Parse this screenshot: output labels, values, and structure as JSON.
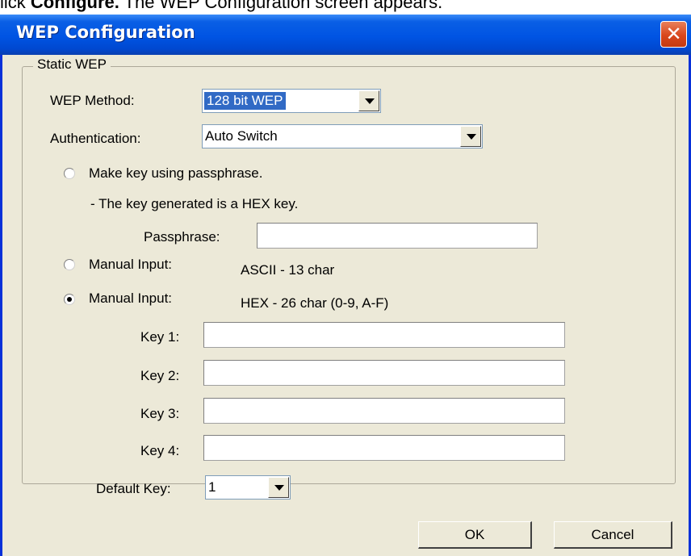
{
  "doc": {
    "prefix": "lick ",
    "bold": "Configure.",
    "suffix": " The WEP Configuration screen appears."
  },
  "window": {
    "title": "WEP Configuration",
    "close_glyph": "✕"
  },
  "group": {
    "legend": "Static WEP"
  },
  "wep_method": {
    "label": "WEP Method:",
    "value": "128 bit WEP"
  },
  "authentication": {
    "label": "Authentication:",
    "value": "Auto Switch"
  },
  "passphrase_option": {
    "label": "Make key using passphrase.",
    "note": "- The key generated is a HEX key.",
    "field_label": "Passphrase:",
    "field_value": ""
  },
  "manual_ascii": {
    "label": "Manual Input:",
    "desc": "ASCII - 13 char",
    "checked": false
  },
  "manual_hex": {
    "label": "Manual Input:",
    "desc": "HEX - 26 char (0-9, A-F)",
    "checked": true
  },
  "keys": [
    {
      "label": "Key 1:",
      "value": ""
    },
    {
      "label": "Key 2:",
      "value": ""
    },
    {
      "label": "Key 3:",
      "value": ""
    },
    {
      "label": "Key 4:",
      "value": ""
    }
  ],
  "default_key": {
    "label": "Default Key:",
    "value": "1"
  },
  "buttons": {
    "ok": "OK",
    "cancel": "Cancel"
  },
  "colors": {
    "title_bar": "#0054e3",
    "dialog_bg": "#ece9d8",
    "selection": "#316ac5",
    "close_button": "#d9461c"
  }
}
